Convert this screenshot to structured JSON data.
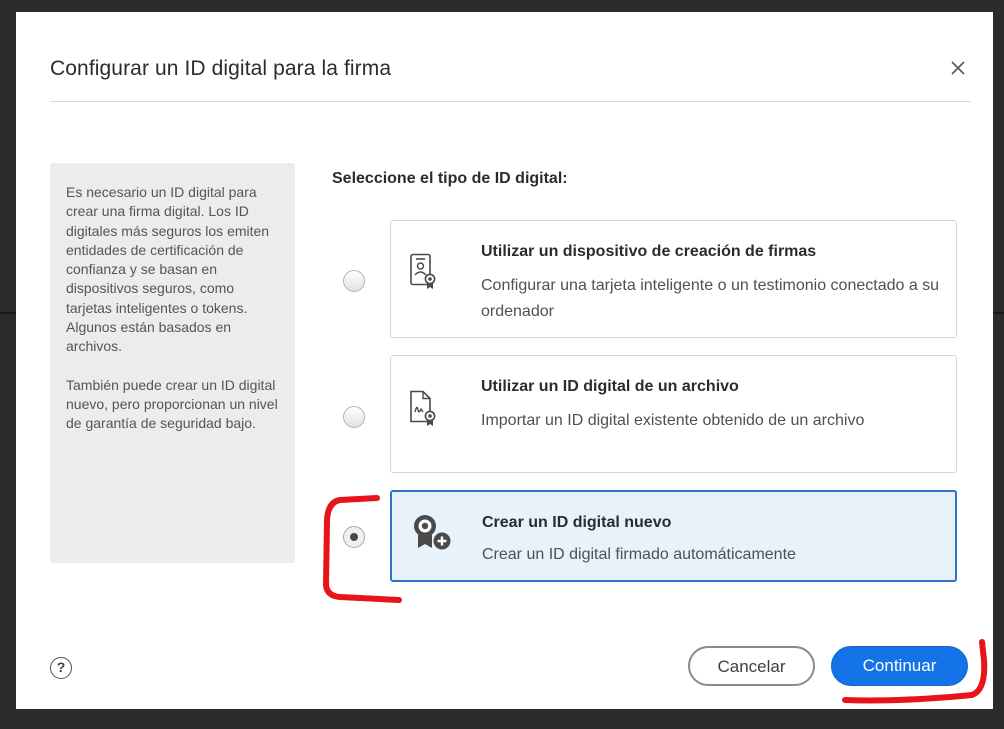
{
  "dialog": {
    "title": "Configurar un ID digital para la firma",
    "close_icon": "close-icon",
    "help_label": "?"
  },
  "info_panel": {
    "paragraph1": "Es necesario un ID digital para crear una firma digital. Los ID digitales más seguros los emiten entidades de certificación de confianza y se basan en dispositivos seguros, como tarjetas inteligentes o tokens. Algunos están basados en archivos.",
    "paragraph2": "También puede crear un ID digital nuevo, pero proporcionan un nivel de garantía de seguridad bajo."
  },
  "options": {
    "heading": "Seleccione el tipo de ID digital:",
    "selected_index": 2,
    "items": [
      {
        "title": "Utilizar un dispositivo de creación de firmas",
        "description": "Configurar una tarjeta inteligente o un testimonio conectado a su ordenador",
        "icon": "smart-card-icon"
      },
      {
        "title": "Utilizar un ID digital de un archivo",
        "description": "Importar un ID digital existente obtenido de un archivo",
        "icon": "certificate-file-icon"
      },
      {
        "title": "Crear un ID digital nuevo",
        "description": "Crear un ID digital firmado automáticamente",
        "icon": "new-badge-icon"
      }
    ]
  },
  "buttons": {
    "cancel": "Cancelar",
    "continue": "Continuar"
  },
  "colors": {
    "accent": "#1473e6",
    "selected_bg": "#e8f2fb",
    "annotation": "#e8141b"
  }
}
